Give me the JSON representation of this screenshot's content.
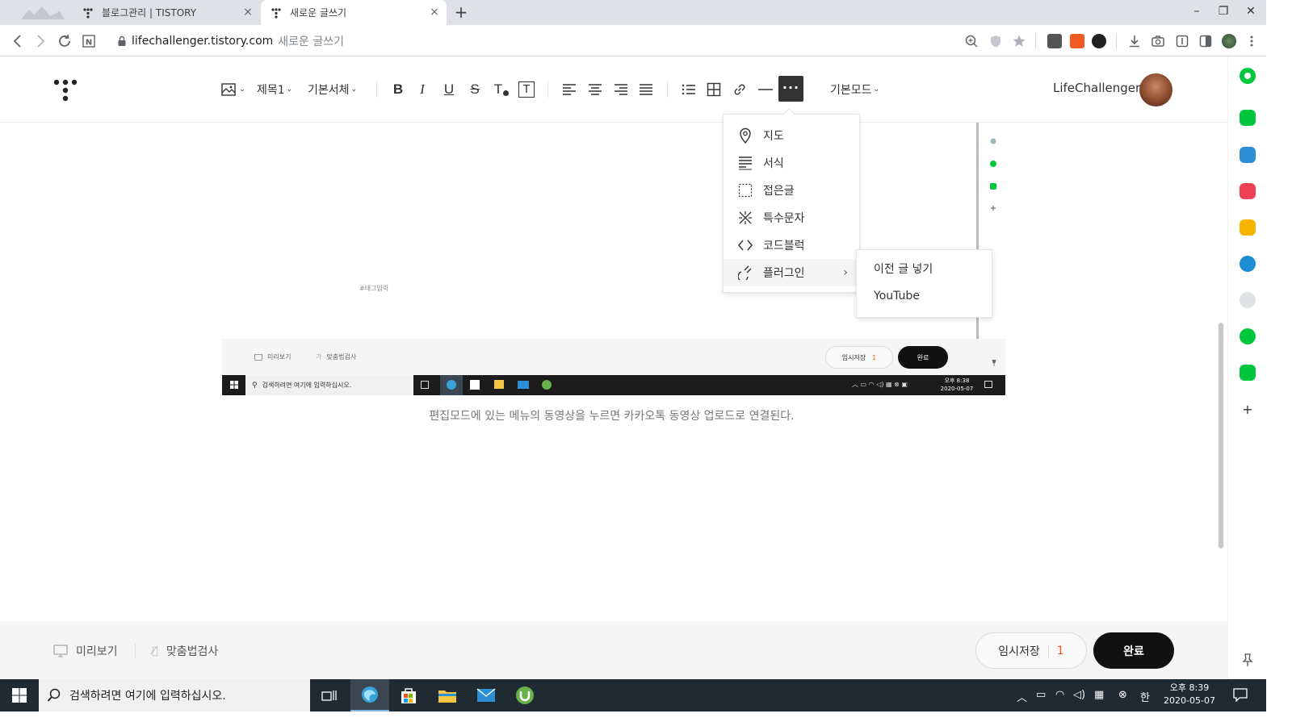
{
  "browser": {
    "tabs": [
      {
        "title": "블로그관리 | TISTORY",
        "active": false
      },
      {
        "title": "새로운 글쓰기",
        "active": true
      }
    ],
    "new_tab": "+",
    "url_host": "lifechallenger.tistory.com",
    "url_page_title": "새로운 글쓰기"
  },
  "toolbar": {
    "heading_select": "제목1",
    "font_select": "기본서체",
    "bold": "B",
    "italic": "I",
    "underline": "U",
    "strike": "S",
    "text_color": "T",
    "text_bg": "T",
    "more": "···",
    "mode_select": "기본모드",
    "username": "LifeChallenger"
  },
  "more_menu": {
    "items": [
      {
        "label": "지도",
        "icon": "map-pin-icon"
      },
      {
        "label": "서식",
        "icon": "template-icon"
      },
      {
        "label": "접은글",
        "icon": "fold-icon"
      },
      {
        "label": "특수문자",
        "icon": "special-char-icon"
      },
      {
        "label": "코드블럭",
        "icon": "code-icon"
      },
      {
        "label": "플러그인",
        "icon": "plugin-icon",
        "has_submenu": true
      }
    ],
    "submenu": [
      {
        "label": "이전 글 넣기"
      },
      {
        "label": "YouTube"
      }
    ]
  },
  "content": {
    "tag_placeholder": "#태그입력",
    "caption": "편집모드에 있는 메뉴의 동영상을 누르면 카카오톡 동영상 업로드로 연결된다.",
    "embed": {
      "preview": "미리보기",
      "spell": "맞춤법검사",
      "draft": "임시저장",
      "draft_count": "1",
      "done": "완료",
      "search": "검색하려면 여기에 입력하십시오.",
      "time": "오후 8:38",
      "date": "2020-05-07"
    }
  },
  "bottombar": {
    "preview": "미리보기",
    "spell_check": "맞춤법검사",
    "draft": "임시저장",
    "draft_count": "1",
    "done": "완료"
  },
  "taskbar": {
    "search_placeholder": "검색하려면 여기에 입력하십시오.",
    "time": "오후 8:39",
    "date": "2020-05-07",
    "ime": "한"
  },
  "colors": {
    "accent_orange": "#f15a22",
    "done_button": "#111111",
    "side_green": "#00c73c"
  }
}
